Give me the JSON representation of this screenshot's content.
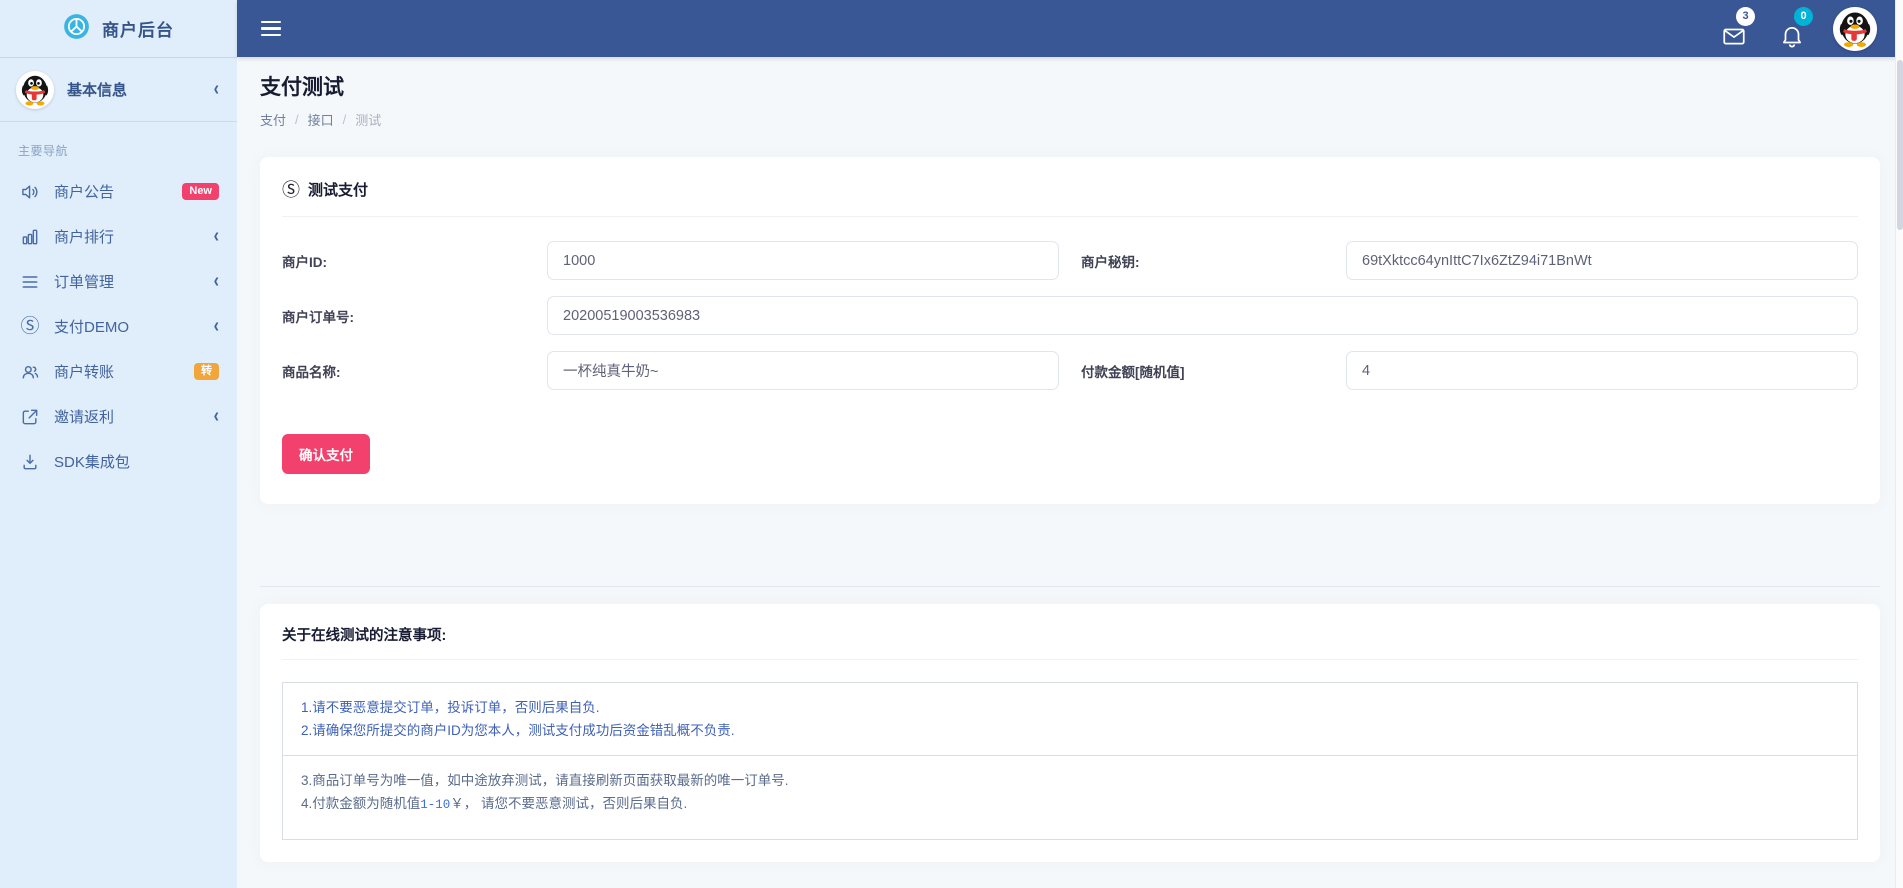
{
  "sidebar": {
    "logo_title": "商户后台",
    "user_label": "基本信息",
    "nav_label": "主要导航",
    "items": [
      {
        "label": "商户公告",
        "badge": "New"
      },
      {
        "label": "商户排行"
      },
      {
        "label": "订单管理"
      },
      {
        "label": "支付DEMO"
      },
      {
        "label": "商户转账",
        "badge": "转"
      },
      {
        "label": "邀请返利"
      },
      {
        "label": "SDK集成包"
      }
    ]
  },
  "topbar": {
    "mail_badge": "3",
    "bell_badge": "0"
  },
  "page": {
    "title": "支付测试",
    "breadcrumb_1": "支付",
    "breadcrumb_2": "接口",
    "breadcrumb_3": "测试",
    "separator": "/"
  },
  "form_card": {
    "header_icon": "Ⓢ",
    "header": "测试支付",
    "merchant_id_label": "商户ID:",
    "merchant_id_value": "1000",
    "merchant_key_label": "商户秘钥:",
    "merchant_key_value": "69tXktcc64ynIttC7Ix6ZtZ94i71BnWt",
    "order_no_label": "商户订单号:",
    "order_no_value": "20200519003536983",
    "product_label": "商品名称:",
    "product_value": "一杯纯真牛奶~",
    "amount_label": "付款金额[随机值]",
    "amount_value": "4",
    "submit_label": "确认支付"
  },
  "notes_card": {
    "header": "关于在线测试的注意事项:",
    "line1": "1.请不要恶意提交订单，投诉订单，否则后果自负.",
    "line2": "2.请确保您所提交的商户ID为您本人，测试支付成功后资金错乱概不负责.",
    "line3": "3.商品订单号为唯一值，如中途放弃测试，请直接刷新页面获取最新的唯一订单号.",
    "line4_prefix": "4.付款金额为随机值",
    "line4_code": "1-10",
    "line4_suffix": "￥， 请您不要恶意测试，否则后果自负."
  },
  "icons": {
    "chevron": "‹"
  },
  "colors": {
    "topbar_blue": "#3a5795",
    "sidebar_bg": "#e0edfa",
    "accent_pink": "#f1416c",
    "badge_orange": "#f0a63a",
    "badge_cyan": "#00b3d7"
  }
}
